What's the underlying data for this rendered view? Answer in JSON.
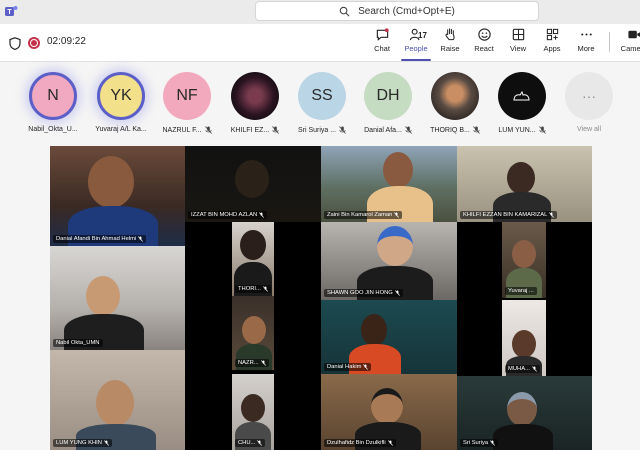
{
  "search": {
    "label": "Search (Cmd+Opt+E)"
  },
  "meeting": {
    "timer": "02:09:22"
  },
  "toolbar": {
    "chat": "Chat",
    "people": "People",
    "people_count": "17",
    "raise": "Raise",
    "react": "React",
    "view": "View",
    "apps": "Apps",
    "more": "More",
    "camera": "Camera"
  },
  "strip": [
    {
      "initials": "N",
      "name": "Nabil_Okta_U...",
      "bg": "#f0a9c0",
      "speaking": true,
      "muted": false
    },
    {
      "initials": "YK",
      "name": "Yuvaraj A/L Ka...",
      "bg": "#f2e08a",
      "speaking": true,
      "muted": false
    },
    {
      "initials": "NF",
      "name": "NAZRUL F...",
      "bg": "#f2a9bd",
      "speaking": false,
      "muted": true
    },
    {
      "initials": "",
      "name": "KHILFI EZ...",
      "bg": "",
      "speaking": false,
      "muted": true
    },
    {
      "initials": "SS",
      "name": "Sri Suriya ...",
      "bg": "#b9d5e6",
      "speaking": false,
      "muted": true
    },
    {
      "initials": "DH",
      "name": "Danial Afa...",
      "bg": "#c5dcc2",
      "speaking": false,
      "muted": true
    },
    {
      "initials": "",
      "name": "THORIQ B...",
      "bg": "",
      "speaking": false,
      "muted": true
    },
    {
      "initials": "",
      "name": "LUM YUN...",
      "bg": "#0e0e0e",
      "speaking": false,
      "muted": true
    },
    {
      "initials": "···",
      "name": "View all",
      "bg": "#e8e8e8",
      "speaking": false,
      "muted": false
    }
  ],
  "tiles": [
    {
      "name": "Danial Afandi Bin Ahmad Helmi",
      "muted": true
    },
    {
      "name": "IZZAT BIN MOHD AZLAN",
      "muted": true
    },
    {
      "name": "Zaini Bin Kamarol Zaman",
      "muted": true
    },
    {
      "name": "KHILFI EZZAN BIN KAMARIZAL",
      "muted": true
    },
    {
      "name": "THORI...",
      "muted": true
    },
    {
      "name": "SHAWN GOO JIN HONG",
      "muted": true
    },
    {
      "name": "Yuvaraj ...",
      "muted": false
    },
    {
      "name": "Nabil Okta_UMN",
      "muted": false
    },
    {
      "name": "NAZR...",
      "muted": true
    },
    {
      "name": "Danial Hakim",
      "muted": true
    },
    {
      "name": "MUHA...",
      "muted": true
    },
    {
      "name": "LUM YUNG KHIN",
      "muted": true
    },
    {
      "name": "CHU...",
      "muted": true
    },
    {
      "name": "Dzulhafidz Bin Dzulkifli",
      "muted": true
    },
    {
      "name": "Sri Suriya",
      "muted": true
    }
  ]
}
